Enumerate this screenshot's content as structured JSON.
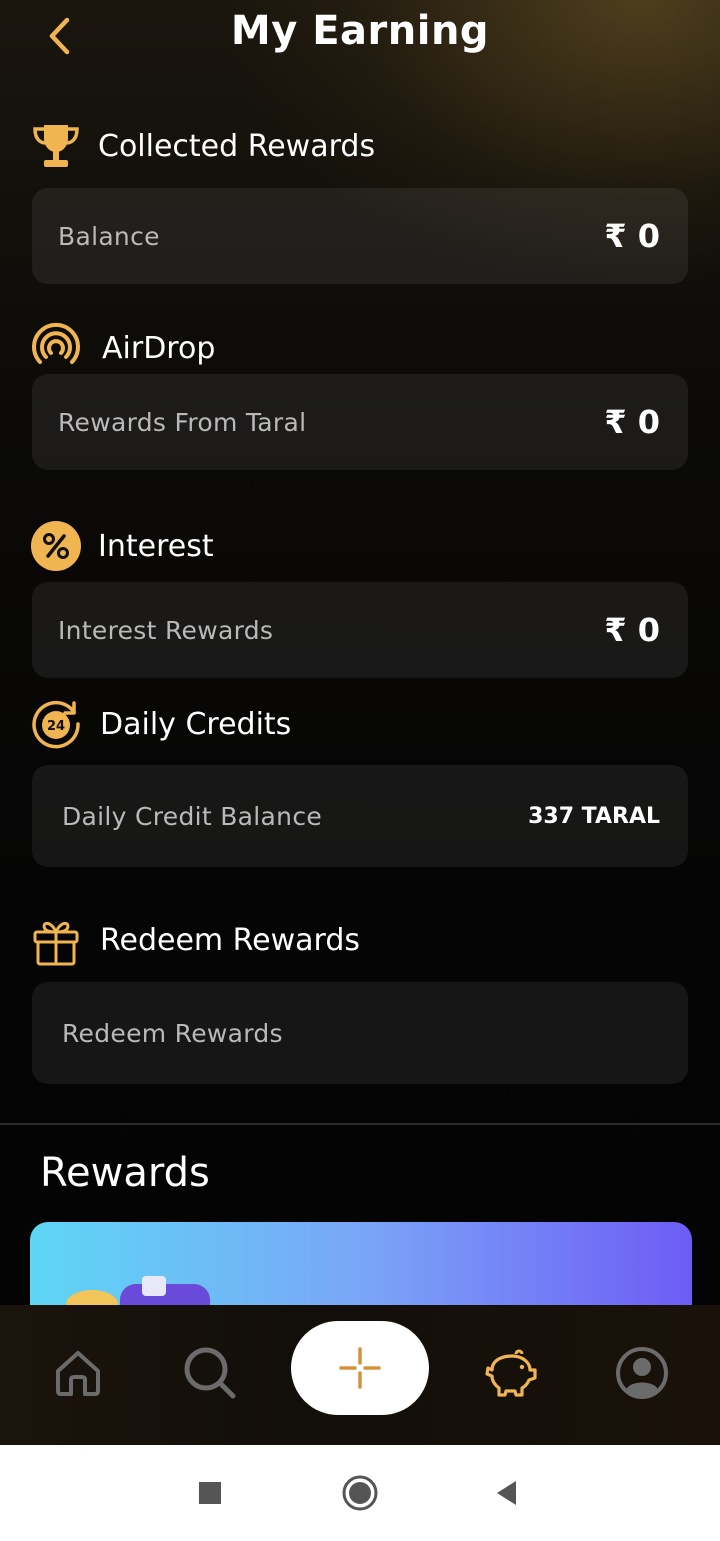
{
  "header": {
    "title": "My Earning",
    "back_icon": "chevron-left-icon"
  },
  "sections": {
    "collected": {
      "title": "Collected Rewards",
      "icon": "trophy-icon",
      "row_label": "Balance",
      "row_value": "₹ 0"
    },
    "airdrop": {
      "title": "AirDrop",
      "icon": "airdrop-icon",
      "row_label": "Rewards From Taral",
      "row_value": "₹ 0"
    },
    "interest": {
      "title": "Interest",
      "icon": "percent-icon",
      "row_label": "Interest Rewards",
      "row_value": "₹ 0"
    },
    "daily": {
      "title": "Daily Credits",
      "icon": "clock-24-icon",
      "row_label": "Daily Credit Balance",
      "row_value": "337 TARAL",
      "badge_text": "24"
    },
    "redeem": {
      "title": "Redeem Rewards",
      "icon": "gift-icon",
      "row_label": "Redeem Rewards"
    }
  },
  "rewards": {
    "title": "Rewards"
  },
  "tabbar": {
    "items": [
      "home-icon",
      "search-icon",
      "plus-icon",
      "piggy-bank-icon",
      "profile-icon"
    ],
    "active": "piggy-bank-icon"
  },
  "colors": {
    "accent": "#f0b450",
    "card_bg": "#1a1a1a",
    "background": "#050505"
  }
}
